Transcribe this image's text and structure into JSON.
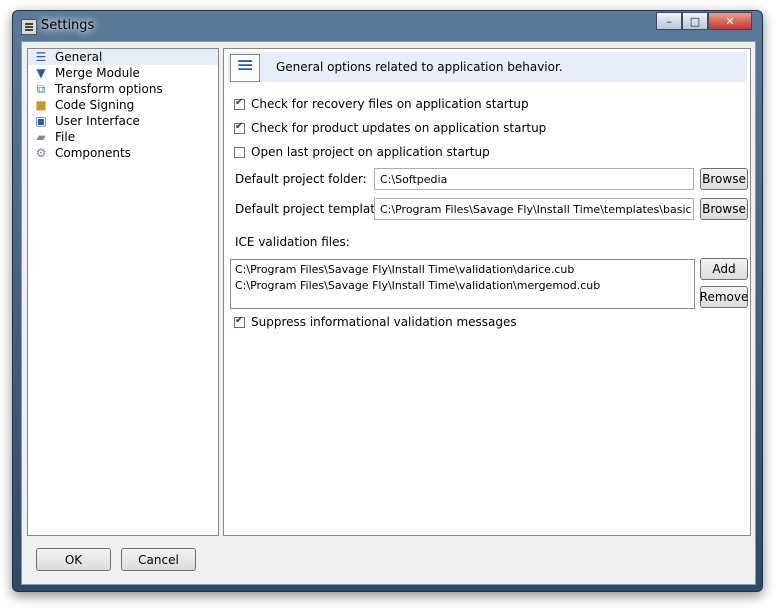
{
  "window": {
    "title": "Settings"
  },
  "sidebar": {
    "items": [
      {
        "label": "General",
        "icon": "list-icon",
        "selected": true
      },
      {
        "label": "Merge Module",
        "icon": "funnel-icon"
      },
      {
        "label": "Transform options",
        "icon": "transform-icon"
      },
      {
        "label": "Code Signing",
        "icon": "lock-icon"
      },
      {
        "label": "User Interface",
        "icon": "dialog-icon"
      },
      {
        "label": "File",
        "icon": "drive-icon"
      },
      {
        "label": "Components",
        "icon": "gear-icon"
      }
    ]
  },
  "content": {
    "header_text": "General options related to application behavior.",
    "options": {
      "recovery": {
        "label": "Check for recovery files on application startup",
        "checked": true
      },
      "updates": {
        "label": "Check for product updates on application startup",
        "checked": true
      },
      "open_last": {
        "label": "Open last project on application startup",
        "checked": false
      }
    },
    "default_folder": {
      "label": "Default project folder:",
      "value": "C:\\Softpedia",
      "button": "Browse"
    },
    "default_template": {
      "label": "Default project template:",
      "value": "C:\\Program Files\\Savage Fly\\Install Time\\templates\\basic ins",
      "button": "Browse"
    },
    "ice": {
      "label": "ICE validation files:",
      "files": [
        "C:\\Program Files\\Savage Fly\\Install Time\\validation\\darice.cub",
        "C:\\Program Files\\Savage Fly\\Install Time\\validation\\mergemod.cub"
      ],
      "add_button": "Add",
      "remove_button": "Remove"
    },
    "suppress": {
      "label": "Suppress informational validation messages",
      "checked": true
    }
  },
  "footer": {
    "ok": "OK",
    "cancel": "Cancel"
  },
  "caption": {
    "minimize": "–",
    "maximize": "□",
    "close": "✕"
  }
}
